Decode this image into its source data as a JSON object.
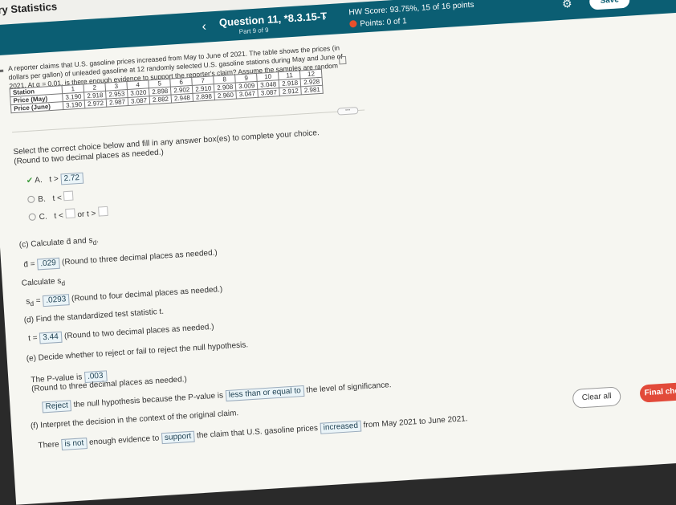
{
  "app": {
    "title": "ry Statistics"
  },
  "header": {
    "question_title": "Question 11, *8.3.15-T",
    "part": "Part 9 of 9",
    "hw_score": "HW Score: 93.75%, 15 of 16 points",
    "points": "Points: 0 of 1",
    "save_label": "Save"
  },
  "problem": {
    "text": "A reporter claims that U.S. gasoline prices increased from May to June of 2021. The table shows the prices (in dollars per gallon) of unleaded gasoline at 12 randomly selected U.S. gasoline stations during May and June of 2021. At α = 0.01, is there enough evidence to support the reporter's claim? Assume the samples are random and dependent, and the populations are normally distributed. Complete parts (a) through (f).",
    "table": {
      "header": "Station",
      "stations": [
        "1",
        "2",
        "3",
        "4",
        "5",
        "6",
        "7",
        "8",
        "9",
        "10",
        "11",
        "12"
      ],
      "rows": [
        {
          "label": "Price (May)",
          "values": [
            "3.190",
            "2.918",
            "2.953",
            "3.020",
            "2.898",
            "2.902",
            "2.910",
            "2.908",
            "3.009",
            "3.048",
            "2.918",
            "2.928"
          ]
        },
        {
          "label": "Price (June)",
          "values": [
            "3.190",
            "2.972",
            "2.987",
            "3.087",
            "2.882",
            "2.948",
            "2.898",
            "2.960",
            "3.047",
            "3.087",
            "2.912",
            "2.981"
          ]
        }
      ]
    }
  },
  "partb": {
    "instruction": "Select the correct choice below and fill in any answer box(es) to complete your choice.",
    "round_note": "(Round to two decimal places as needed.)",
    "option_a_letter": "A.",
    "option_a_text": "t >",
    "option_a_value": "2.72",
    "option_b_letter": "B.",
    "option_b_text": "t <",
    "option_c_letter": "C.",
    "option_c_text": "t <",
    "option_c_mid": "or t >"
  },
  "partc": {
    "prompt": "(c) Calculate d̄ and s",
    "prompt_sub": "d",
    "prompt_end": ".",
    "dbar_label": "d̄ =",
    "dbar_value": ".029",
    "dbar_note": "(Round to three decimal places as needed.)",
    "calc_sd": "Calculate s",
    "sd_label": "s",
    "sd_value": ".0293",
    "sd_note": "(Round to four decimal places as needed.)"
  },
  "partd": {
    "prompt": "(d) Find the standardized test statistic t.",
    "t_label": "t =",
    "t_value": "3.44",
    "t_note": "(Round to two decimal places as needed.)"
  },
  "parte": {
    "prompt": "(e) Decide whether to reject or fail to reject the null hypothesis.",
    "pvalue_label": "The P-value is",
    "pvalue": ".003",
    "pvalue_note": "(Round to three decimal places as needed.)",
    "decision": "Reject",
    "reason_start": "the null hypothesis because the P-value is",
    "comparison": "less than or equal to",
    "reason_end": "the level of significance."
  },
  "partf": {
    "prompt": "(f) Interpret the decision in the context of the original claim.",
    "there": "There",
    "is_not": "is not",
    "enough": "enough evidence to",
    "support": "support",
    "claim": "the claim that U.S. gasoline prices",
    "direction": "increased",
    "period": "from May 2021 to June 2021."
  },
  "footer": {
    "clear_label": "Clear all",
    "final_label": "Final check"
  },
  "icons": {
    "settings": "gear-icon",
    "prev": "chevron-left-icon",
    "next": "chevron-right-icon"
  },
  "colors": {
    "header": "#0b5e73",
    "final_check": "#e24a3a",
    "points_icon": "#e7502c"
  }
}
